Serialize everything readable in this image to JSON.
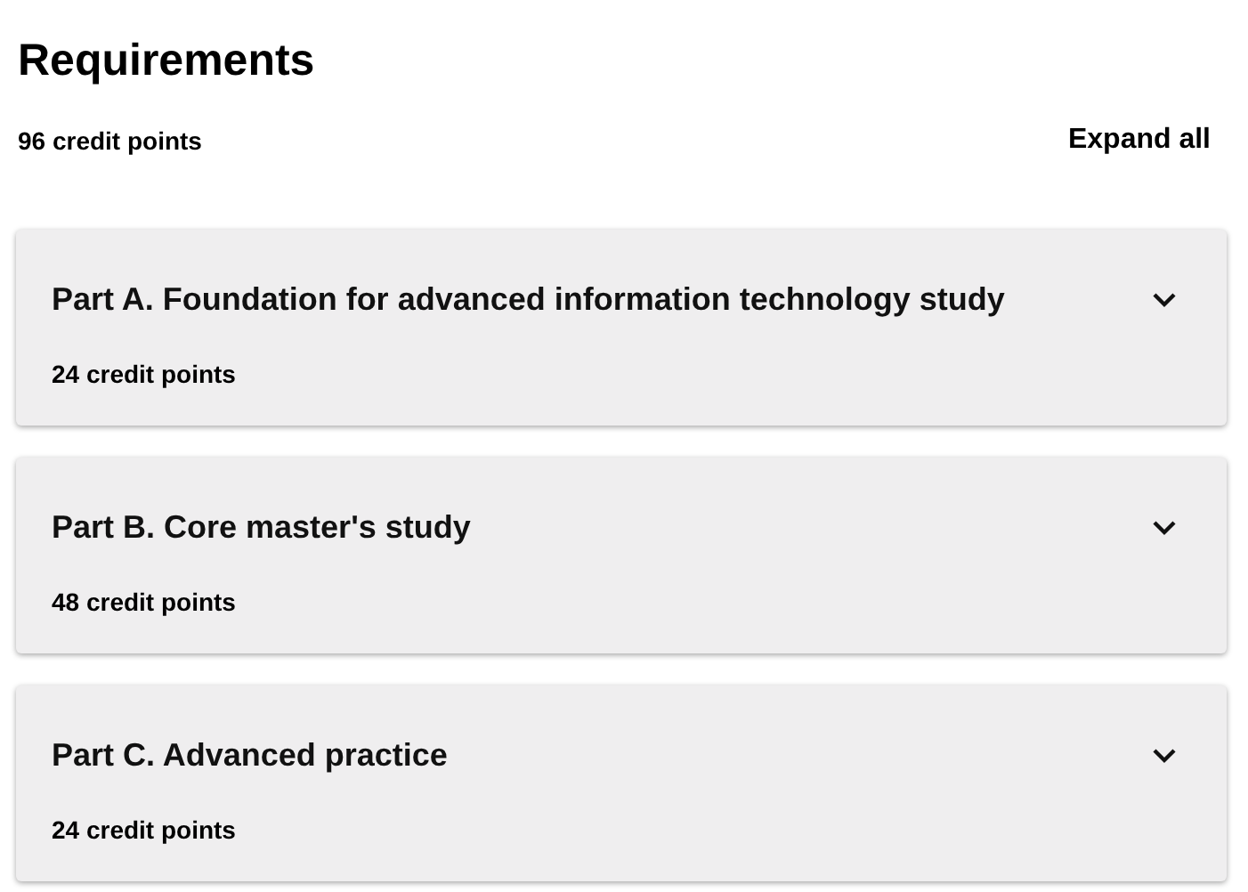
{
  "heading": "Requirements",
  "total": "96 credit points",
  "expand_all": "Expand all",
  "parts": [
    {
      "title": "Part A. Foundation for advanced information technology study",
      "credits": "24 credit points",
      "expanded": false
    },
    {
      "title": "Part B. Core master's study",
      "credits": "48 credit points",
      "expanded": false
    },
    {
      "title": "Part C. Advanced practice",
      "credits": "24 credit points",
      "expanded": false
    }
  ]
}
